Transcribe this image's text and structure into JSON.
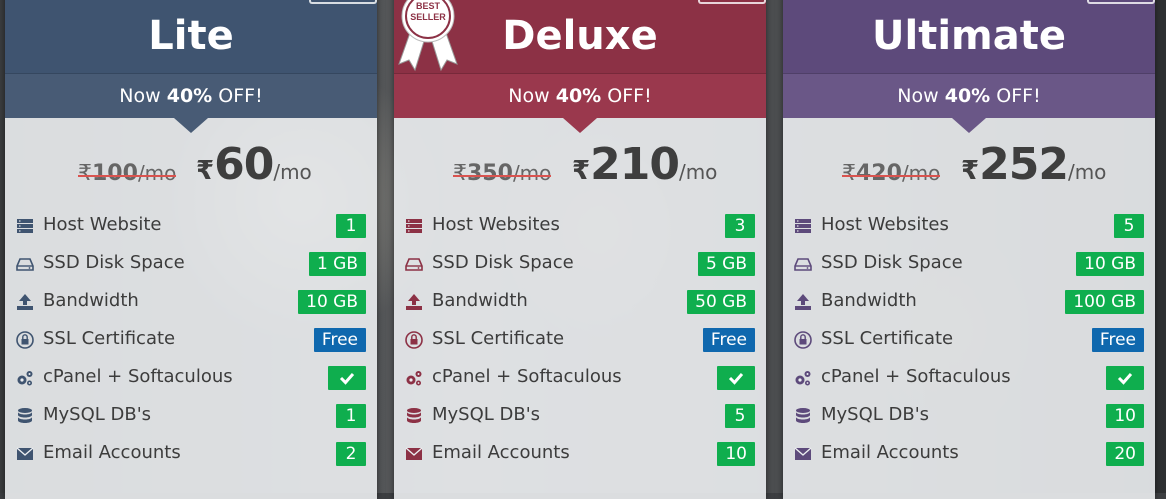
{
  "offer": {
    "prefix": "Now",
    "percent": "40%",
    "suffix": "OFF!"
  },
  "currency_symbol": "₹",
  "per": "/mo",
  "plans": [
    {
      "name": "Lite",
      "old_price": "100",
      "new_price": "60",
      "features": [
        {
          "label": "Host Website",
          "value": "1"
        },
        {
          "label": "SSD Disk Space",
          "value": "1 GB"
        },
        {
          "label": "Bandwidth",
          "value": "10 GB"
        },
        {
          "label": "SSL Certificate",
          "value": "Free"
        },
        {
          "label": "cPanel + Softaculous",
          "value": "check"
        },
        {
          "label": "MySQL DB's",
          "value": "1"
        },
        {
          "label": "Email Accounts",
          "value": "2"
        }
      ]
    },
    {
      "name": "Deluxe",
      "ribbon_text": "BEST SELLER",
      "old_price": "350",
      "new_price": "210",
      "features": [
        {
          "label": "Host Websites",
          "value": "3"
        },
        {
          "label": "SSD Disk Space",
          "value": "5 GB"
        },
        {
          "label": "Bandwidth",
          "value": "50 GB"
        },
        {
          "label": "SSL Certificate",
          "value": "Free"
        },
        {
          "label": "cPanel + Softaculous",
          "value": "check"
        },
        {
          "label": "MySQL DB's",
          "value": "5"
        },
        {
          "label": "Email Accounts",
          "value": "10"
        }
      ]
    },
    {
      "name": "Ultimate",
      "old_price": "420",
      "new_price": "252",
      "features": [
        {
          "label": "Host Websites",
          "value": "5"
        },
        {
          "label": "SSD Disk Space",
          "value": "10 GB"
        },
        {
          "label": "Bandwidth",
          "value": "100 GB"
        },
        {
          "label": "SSL Certificate",
          "value": "Free"
        },
        {
          "label": "cPanel + Softaculous",
          "value": "check"
        },
        {
          "label": "MySQL DB's",
          "value": "10"
        },
        {
          "label": "Email Accounts",
          "value": "20"
        }
      ]
    }
  ],
  "colors": {
    "lite": "#3f5470",
    "deluxe": "#8c3145",
    "ultimate": "#5d4a7b",
    "badge_green": "#0fae4e",
    "badge_blue": "#0f68ae",
    "strike_red": "#d9534f"
  },
  "icons": [
    "server-icon",
    "hdd-icon",
    "upload-icon",
    "lock-shield-icon",
    "cogs-icon",
    "database-icon",
    "envelope-icon"
  ]
}
